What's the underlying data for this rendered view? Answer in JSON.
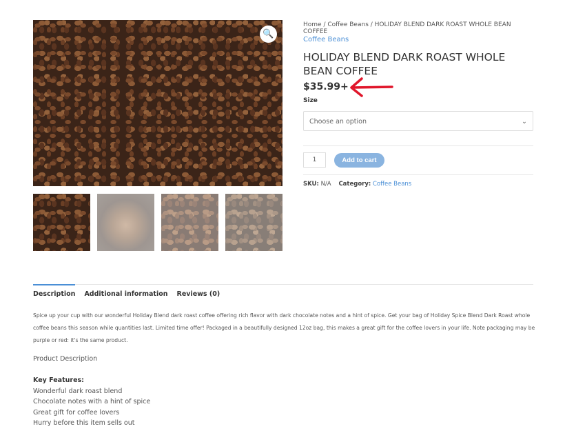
{
  "gallery": {
    "zoom_icon": "magnifier-icon",
    "thumbnail_count": 4
  },
  "product": {
    "breadcrumb": "Home / Coffee Beans / HOLIDAY BLEND DARK ROAST WHOLE BEAN COFFEE",
    "category_link": "Coffee Beans",
    "title": "HOLIDAY BLEND DARK ROAST WHOLE BEAN COFFEE",
    "price": "$35.99+",
    "size_label": "Size",
    "size_placeholder": "Choose an option",
    "quantity": "1",
    "add_to_cart": "Add to cart",
    "sku_label": "SKU:",
    "sku": "N/A",
    "category_label": "Category:",
    "category": "Coffee Beans"
  },
  "annotation": {
    "arrow_color": "#e0162b"
  },
  "tabs": [
    {
      "label": "Description",
      "active": true
    },
    {
      "label": "Additional information"
    },
    {
      "label": "Reviews (0)"
    }
  ],
  "description": {
    "text": "Spice up your cup with our wonderful Holiday Blend dark roast coffee offering rich flavor with dark chocolate notes and a hint of spice. Get your bag of Holiday Spice Blend Dark Roast whole coffee beans this season while quantities last. Limited time offer! Packaged in a beautifully designed 12oz bag, this makes a great gift for the coffee lovers in your life. Note packaging may be purple or red: it's the same product.",
    "heading": "Product Description",
    "features_title": "Key Features:",
    "features": [
      "Wonderful dark roast blend",
      "Chocolate notes with a hint of spice",
      "Great gift for coffee lovers",
      "Hurry before this item sells out"
    ]
  }
}
